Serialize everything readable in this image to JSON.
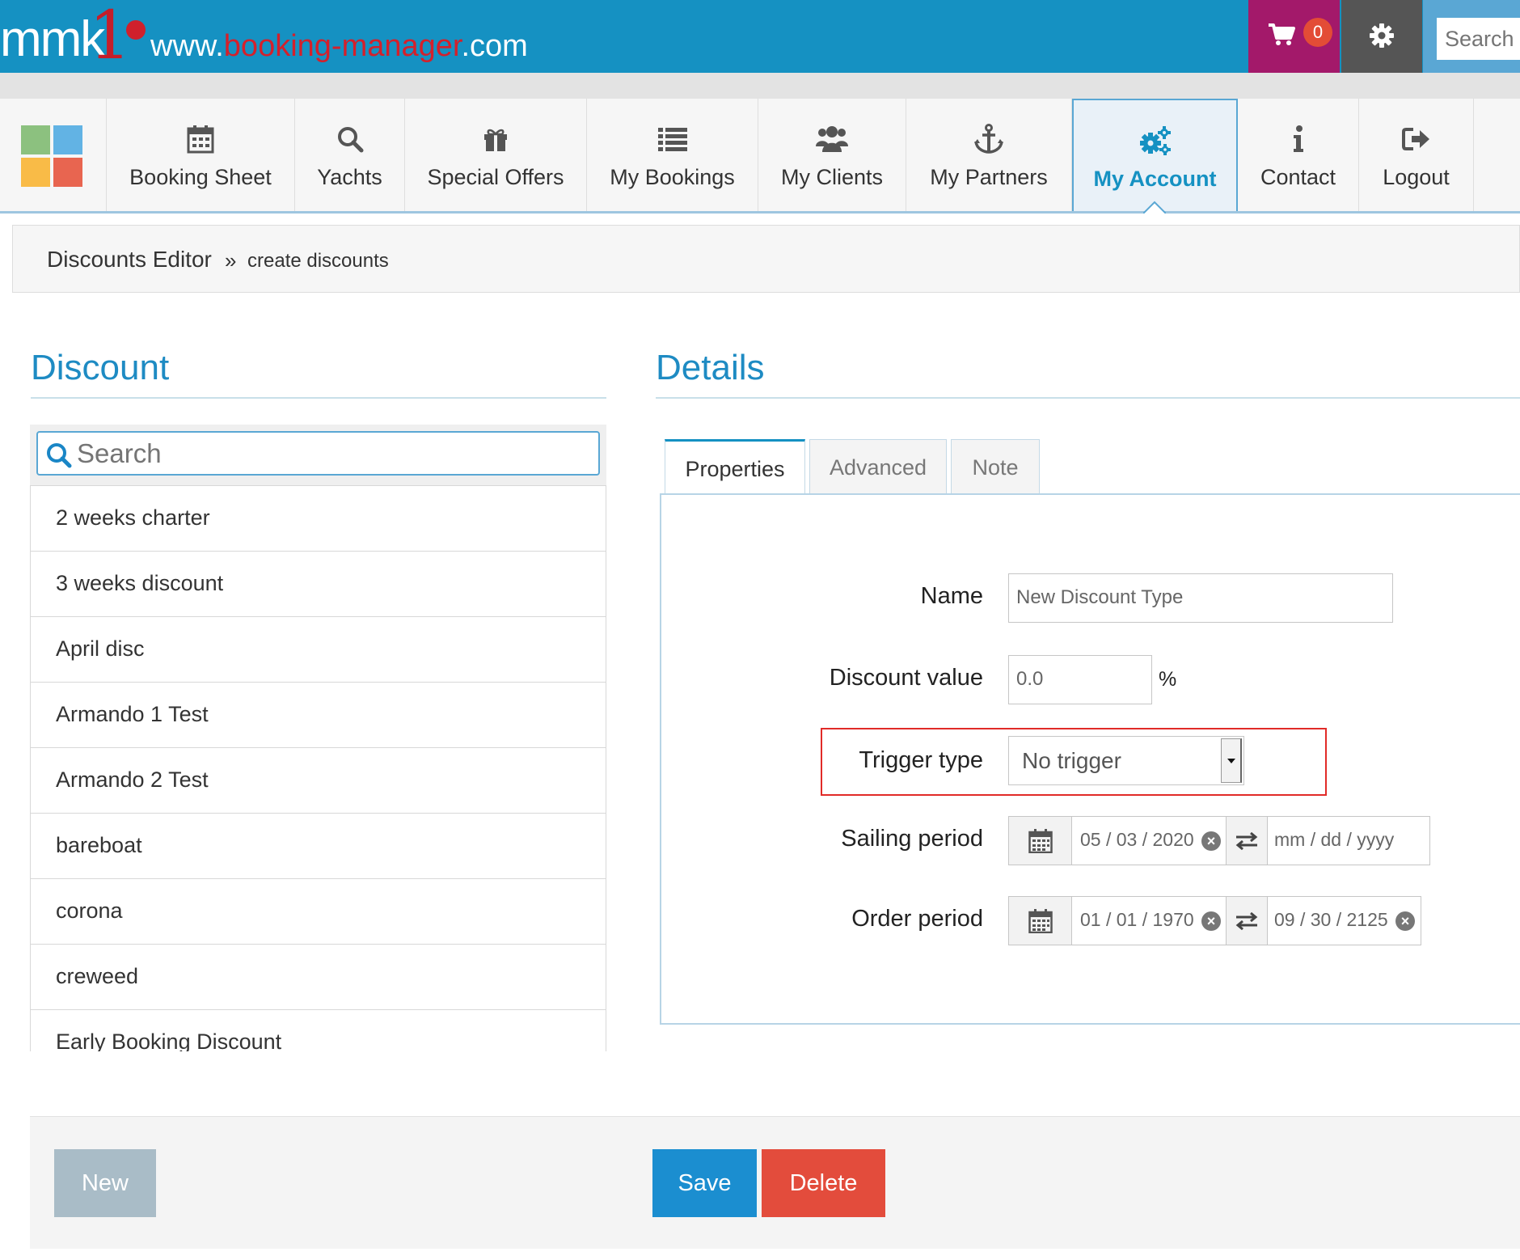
{
  "header": {
    "logo_mmk": "mmk",
    "logo_one": "1",
    "url_prefix": "www.",
    "url_domain": "booking-manager",
    "url_suffix": ".com",
    "cart_count": "0",
    "search_placeholder": "Search"
  },
  "nav": {
    "items": [
      {
        "label": "Booking Sheet",
        "icon": "calendar-icon"
      },
      {
        "label": "Yachts",
        "icon": "search-icon"
      },
      {
        "label": "Special Offers",
        "icon": "gift-icon"
      },
      {
        "label": "My Bookings",
        "icon": "list-icon"
      },
      {
        "label": "My Clients",
        "icon": "users-icon"
      },
      {
        "label": "My Partners",
        "icon": "anchor-icon"
      },
      {
        "label": "My Account",
        "icon": "cogs-icon",
        "active": true
      },
      {
        "label": "Contact",
        "icon": "info-icon"
      },
      {
        "label": "Logout",
        "icon": "sign-out-icon"
      }
    ]
  },
  "breadcrumb": {
    "main": "Discounts Editor",
    "separator": "»",
    "current": "create discounts"
  },
  "discount_panel": {
    "title": "Discount",
    "search_placeholder": "Search",
    "items": [
      "2 weeks charter",
      "3 weeks discount",
      "April disc",
      "Armando 1 Test",
      "Armando 2 Test",
      "bareboat",
      "corona",
      "creweed",
      "Early Booking Discount"
    ]
  },
  "details_panel": {
    "title": "Details",
    "tabs": [
      "Properties",
      "Advanced",
      "Note"
    ],
    "active_tab": "Properties",
    "fields": {
      "name_label": "Name",
      "name_value": "New Discount Type",
      "discount_value_label": "Discount value",
      "discount_value": "0.0",
      "discount_unit": "%",
      "trigger_type_label": "Trigger type",
      "trigger_type_value": "No trigger",
      "sailing_period_label": "Sailing period",
      "sailing_from": "05 / 03 / 2020",
      "sailing_to": "mm / dd / yyyy",
      "order_period_label": "Order period",
      "order_from": "01 / 01 / 1970",
      "order_to": "09 / 30 / 2125"
    }
  },
  "footer": {
    "new_label": "New",
    "save_label": "Save",
    "delete_label": "Delete"
  },
  "colors": {
    "brand_blue": "#1591c2",
    "cart_purple": "#a3196a",
    "save_blue": "#1b8ed0",
    "delete_red": "#e34c3c",
    "new_grey": "#a9bcc7",
    "highlight_red": "#e12b28"
  }
}
